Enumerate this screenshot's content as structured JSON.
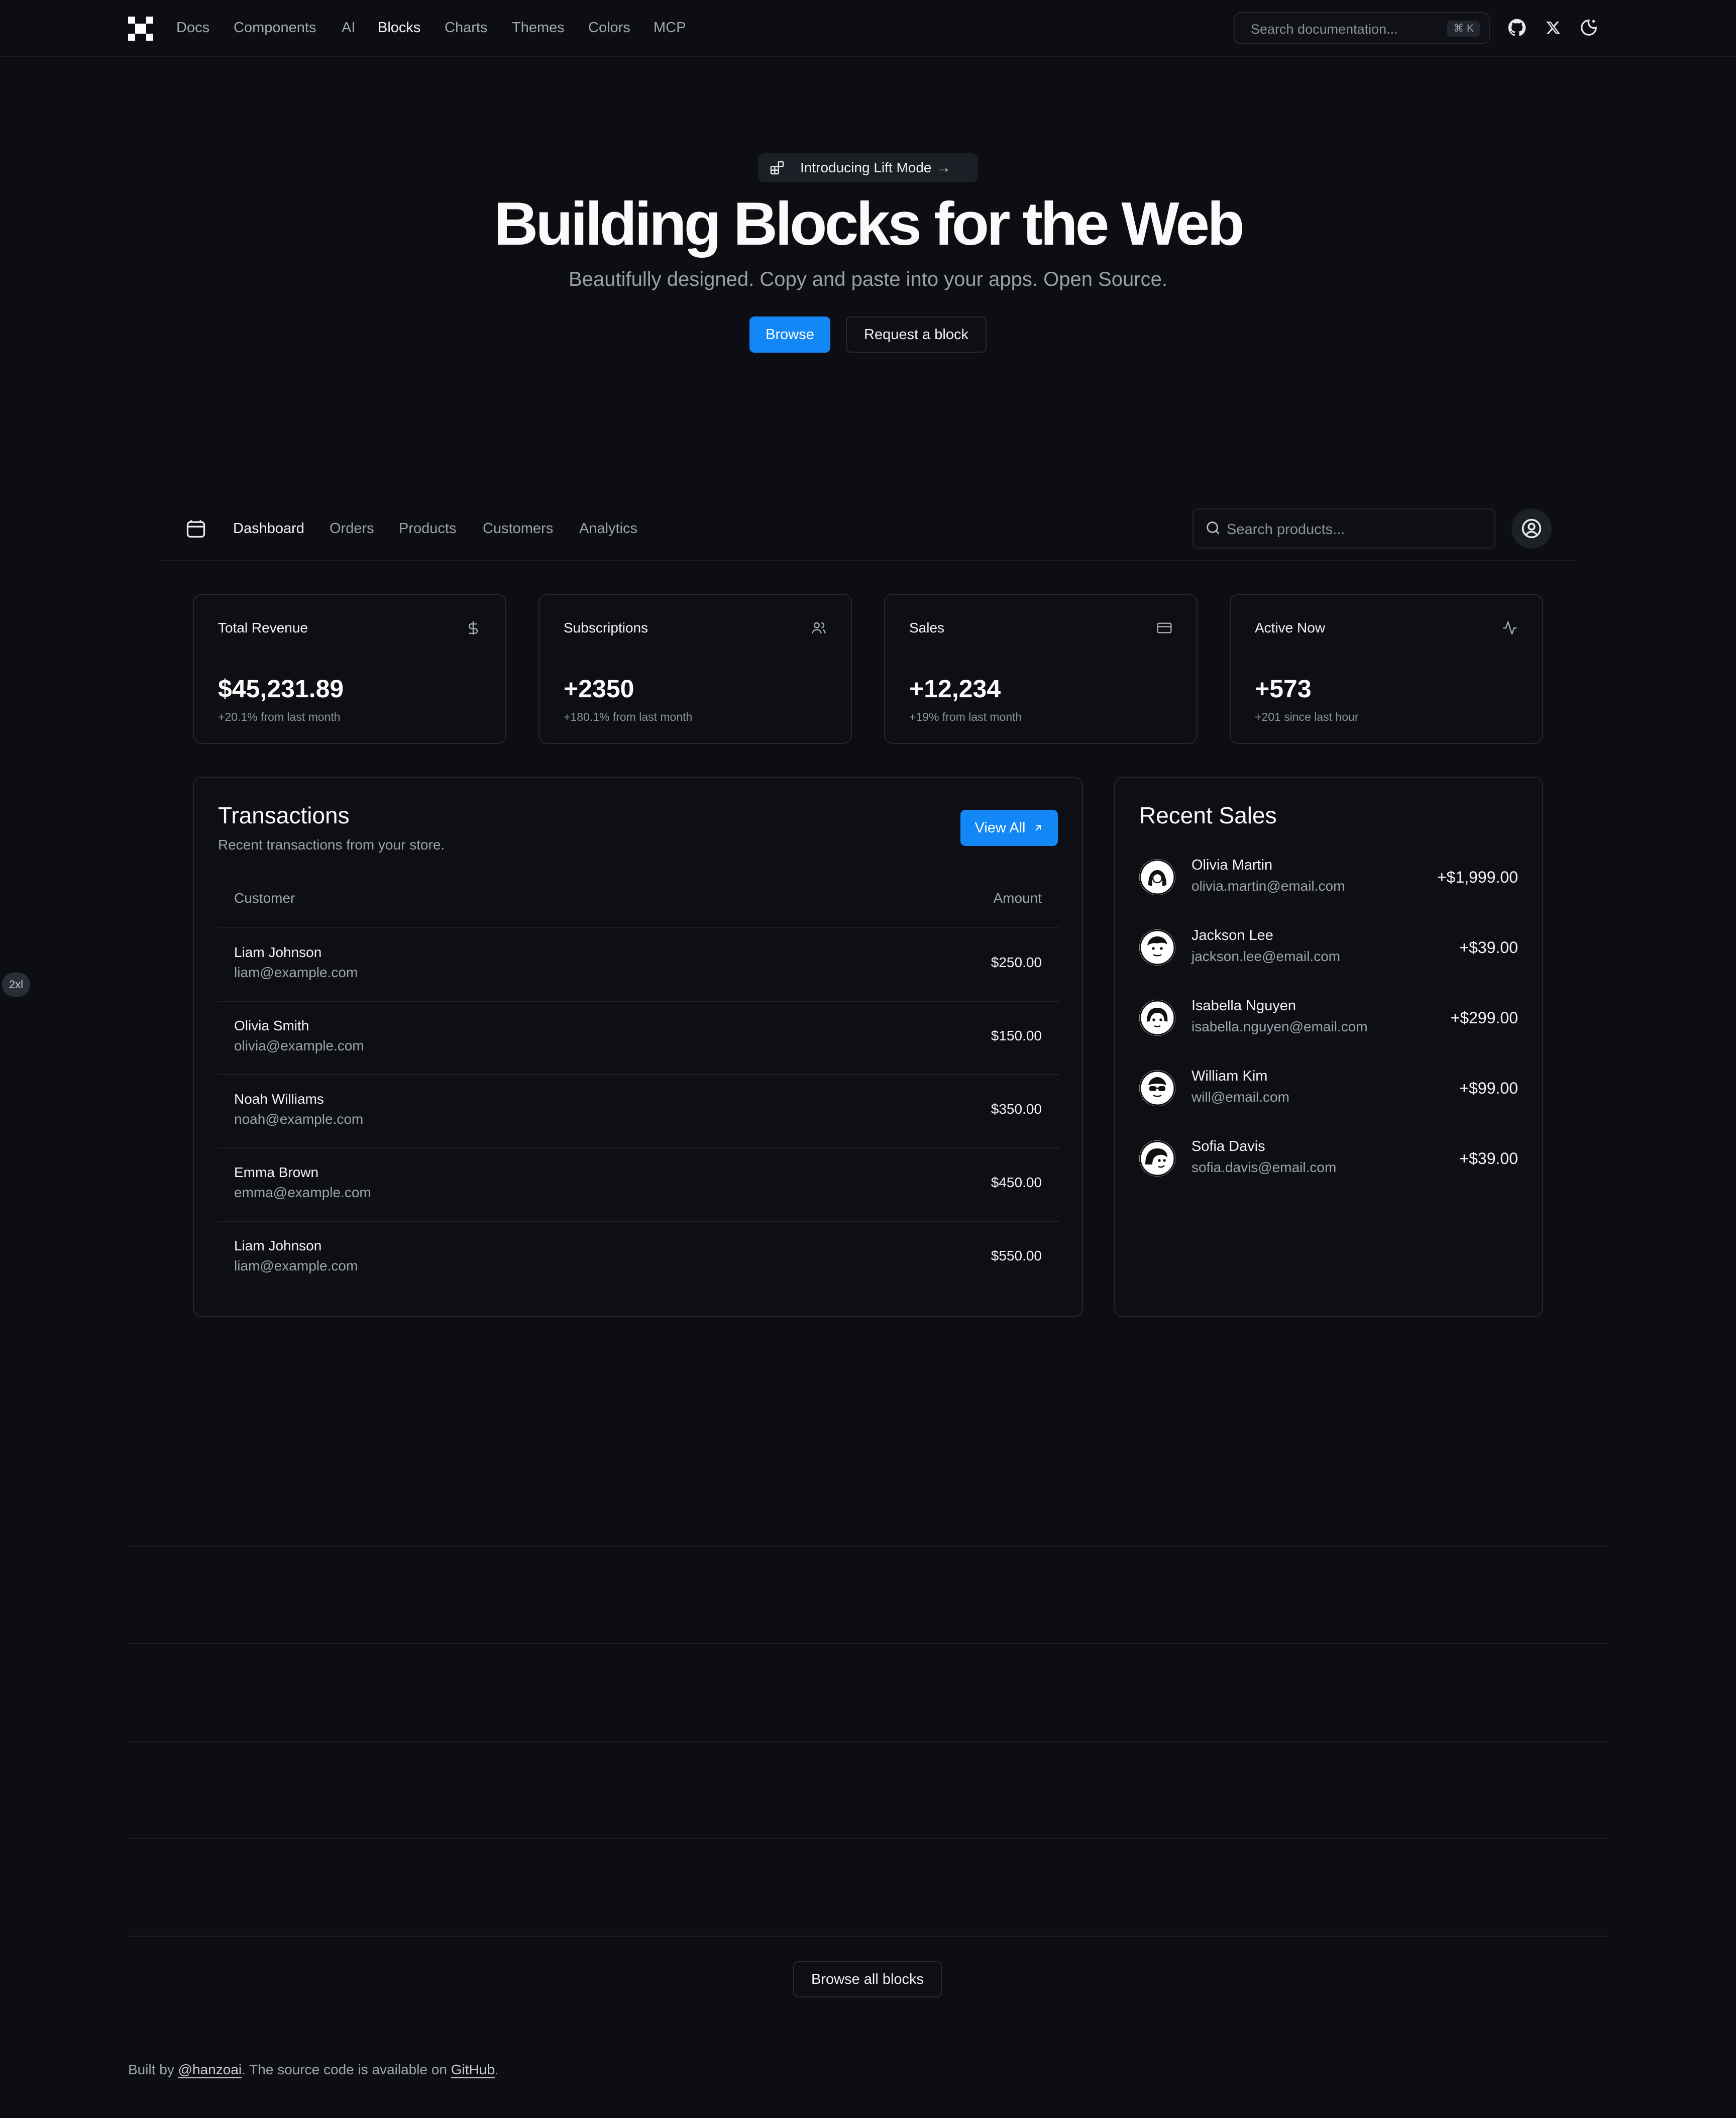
{
  "topnav": {
    "links": [
      "Docs",
      "Components",
      "AI",
      "Blocks",
      "Charts",
      "Themes",
      "Colors",
      "MCP"
    ],
    "active": "Blocks",
    "search": {
      "placeholder": "Search documentation...",
      "shortcut": "⌘ K"
    },
    "icons": [
      "logo-icon",
      "github-icon",
      "x-icon",
      "theme-toggle-icon"
    ]
  },
  "hero": {
    "announcement": "Introducing Lift Mode",
    "title": "Building Blocks for the Web",
    "subtitle": "Beautifully designed. Copy and paste into your apps. Open Source.",
    "primary_cta": "Browse",
    "secondary_cta": "Request a block"
  },
  "dashboard": {
    "nav": {
      "links": [
        "Dashboard",
        "Orders",
        "Products",
        "Customers",
        "Analytics"
      ],
      "active": "Dashboard",
      "search_placeholder": "Search products..."
    },
    "stats": [
      {
        "title": "Total Revenue",
        "value": "$45,231.89",
        "note": "+20.1% from last month",
        "icon": "dollar-icon"
      },
      {
        "title": "Subscriptions",
        "value": "+2350",
        "note": "+180.1% from last month",
        "icon": "users-icon"
      },
      {
        "title": "Sales",
        "value": "+12,234",
        "note": "+19% from last month",
        "icon": "credit-card-icon"
      },
      {
        "title": "Active Now",
        "value": "+573",
        "note": "+201 since last hour",
        "icon": "activity-icon"
      }
    ],
    "transactions": {
      "title": "Transactions",
      "description": "Recent transactions from your store.",
      "view_all": "View All",
      "columns": [
        "Customer",
        "Amount"
      ],
      "rows": [
        {
          "name": "Liam Johnson",
          "email": "liam@example.com",
          "amount": "$250.00"
        },
        {
          "name": "Olivia Smith",
          "email": "olivia@example.com",
          "amount": "$150.00"
        },
        {
          "name": "Noah Williams",
          "email": "noah@example.com",
          "amount": "$350.00"
        },
        {
          "name": "Emma Brown",
          "email": "emma@example.com",
          "amount": "$450.00"
        },
        {
          "name": "Liam Johnson",
          "email": "liam@example.com",
          "amount": "$550.00"
        }
      ]
    },
    "recent_sales": {
      "title": "Recent Sales",
      "items": [
        {
          "name": "Olivia Martin",
          "email": "olivia.martin@email.com",
          "amount": "+$1,999.00"
        },
        {
          "name": "Jackson Lee",
          "email": "jackson.lee@email.com",
          "amount": "+$39.00"
        },
        {
          "name": "Isabella Nguyen",
          "email": "isabella.nguyen@email.com",
          "amount": "+$299.00"
        },
        {
          "name": "William Kim",
          "email": "will@email.com",
          "amount": "+$99.00"
        },
        {
          "name": "Sofia Davis",
          "email": "sofia.davis@email.com",
          "amount": "+$39.00"
        }
      ]
    }
  },
  "breakpoint_badge": "2xl",
  "browse_all": "Browse all blocks",
  "footer": {
    "prefix": "Built by ",
    "author": "@hanzoai",
    "middle": ". The source code is available on ",
    "repo": "GitHub",
    "suffix": "."
  },
  "colors": {
    "accent": "#1287f5",
    "background": "#0c0e13",
    "border": "#22262e"
  }
}
